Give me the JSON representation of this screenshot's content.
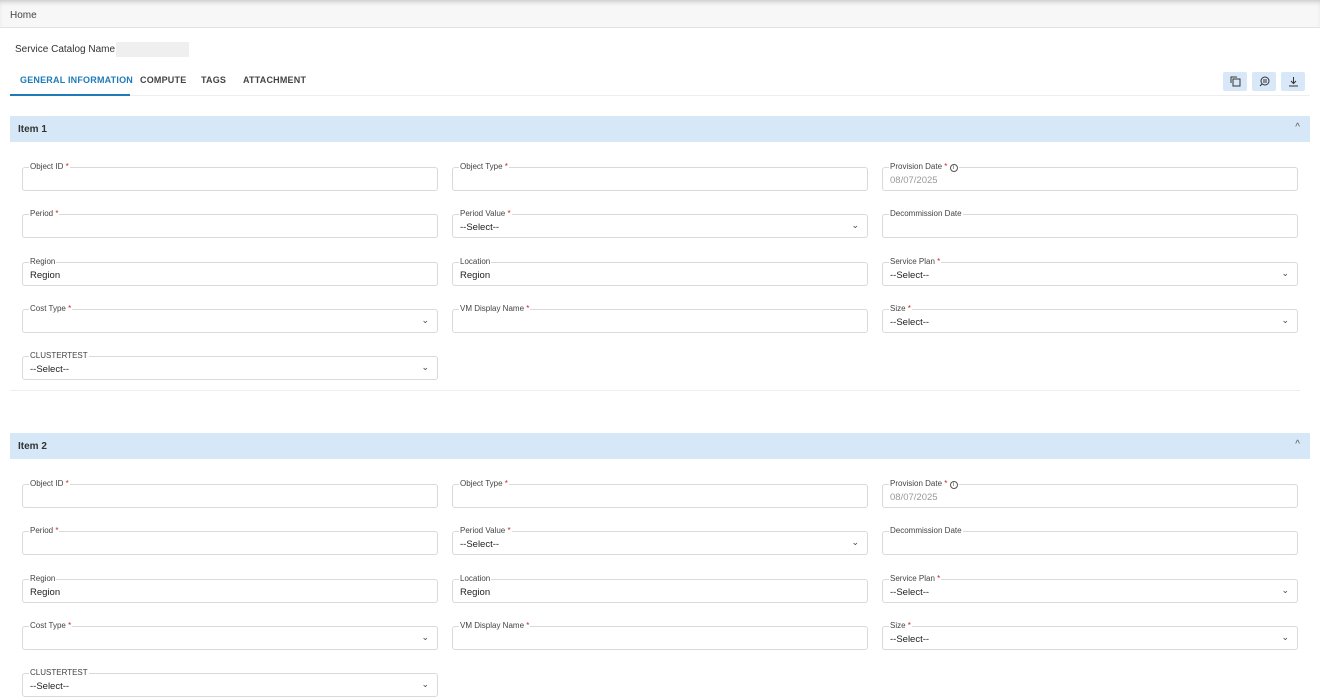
{
  "breadcrumb": "Home",
  "catalog_label": "Service Catalog Name :",
  "tabs": [
    "GENERAL INFORMATION",
    "COMPUTE",
    "TAGS",
    "ATTACHMENT"
  ],
  "toolbar": [
    "copy-icon",
    "comment-icon",
    "download-icon"
  ],
  "collapse_icon": "^",
  "dropdown_icon": "⌄",
  "items": [
    {
      "title": "Item 1",
      "fields": [
        {
          "label": "Object ID",
          "req": true,
          "type": "text",
          "value": ""
        },
        {
          "label": "Object Type",
          "req": true,
          "type": "text",
          "value": ""
        },
        {
          "label": "Provision Date",
          "req": true,
          "info": true,
          "type": "date",
          "value": "08/07/2025",
          "placeholder": true
        },
        {
          "label": "Period",
          "req": true,
          "type": "text",
          "value": ""
        },
        {
          "label": "Period Value",
          "req": true,
          "type": "select",
          "value": "--Select--"
        },
        {
          "label": "Decommission Date",
          "req": false,
          "type": "text",
          "value": ""
        },
        {
          "label": "Region",
          "req": false,
          "type": "text",
          "value": "Region"
        },
        {
          "label": "Location",
          "req": false,
          "type": "text",
          "value": "Region"
        },
        {
          "label": "Service Plan",
          "req": true,
          "type": "select",
          "value": "--Select--"
        },
        {
          "label": "Cost Type",
          "req": true,
          "type": "select",
          "value": ""
        },
        {
          "label": "VM Display Name",
          "req": true,
          "type": "text",
          "value": ""
        },
        {
          "label": "Size",
          "req": true,
          "type": "select",
          "value": "--Select--"
        },
        {
          "label": "CLUSTERTEST",
          "req": false,
          "type": "select",
          "value": "--Select--"
        }
      ]
    },
    {
      "title": "Item 2",
      "fields": [
        {
          "label": "Object ID",
          "req": true,
          "type": "text",
          "value": ""
        },
        {
          "label": "Object Type",
          "req": true,
          "type": "text",
          "value": ""
        },
        {
          "label": "Provision Date",
          "req": true,
          "info": true,
          "type": "date",
          "value": "08/07/2025",
          "placeholder": true
        },
        {
          "label": "Period",
          "req": true,
          "type": "text",
          "value": ""
        },
        {
          "label": "Period Value",
          "req": true,
          "type": "select",
          "value": "--Select--"
        },
        {
          "label": "Decommission Date",
          "req": false,
          "type": "text",
          "value": ""
        },
        {
          "label": "Region",
          "req": false,
          "type": "text",
          "value": "Region"
        },
        {
          "label": "Location",
          "req": false,
          "type": "text",
          "value": "Region"
        },
        {
          "label": "Service Plan",
          "req": true,
          "type": "select",
          "value": "--Select--"
        },
        {
          "label": "Cost Type",
          "req": true,
          "type": "select",
          "value": ""
        },
        {
          "label": "VM Display Name",
          "req": true,
          "type": "text",
          "value": ""
        },
        {
          "label": "Size",
          "req": true,
          "type": "select",
          "value": "--Select--"
        },
        {
          "label": "CLUSTERTEST",
          "req": false,
          "type": "select",
          "value": "--Select--"
        }
      ]
    }
  ]
}
